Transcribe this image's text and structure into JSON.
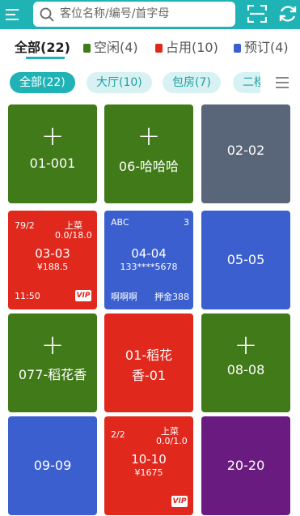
{
  "search": {
    "placeholder": "客位名称/编号/首字母"
  },
  "status_tabs": {
    "all": "全部(22)",
    "idle": "空闲(4)",
    "occupied": "占用(10)",
    "reserved": "预订(4)"
  },
  "colors": {
    "accent": "#1fb3b5",
    "idle": "#417a19",
    "occupied": "#e0281c",
    "reserved": "#3b5fcf",
    "gray": "#596579",
    "purple": "#6a1b7f"
  },
  "area_tabs": [
    "全部(22)",
    "大厅(10)",
    "包房(7)",
    "二楼"
  ],
  "tables": {
    "t1": {
      "name": "01-001"
    },
    "t2": {
      "name": "06-哈哈哈"
    },
    "t3": {
      "name": "02-02"
    },
    "t4": {
      "guests": "79/2",
      "status": "上菜",
      "progress": "0.0/18.0",
      "name": "03-03",
      "amount": "¥188.5",
      "time": "11:50",
      "vip": "VIP"
    },
    "t5": {
      "label": "ABC",
      "count": "3",
      "name": "04-04",
      "phone": "133****5678",
      "note": "啊啊啊",
      "deposit": "押金388"
    },
    "t6": {
      "name": "05-05"
    },
    "t7": {
      "name": "077-稻花香"
    },
    "t8": {
      "name_line1": "01-稻花",
      "name_line2": "香-01"
    },
    "t9": {
      "name": "08-08"
    },
    "t10": {
      "name": "09-09"
    },
    "t11": {
      "guests": "2/2",
      "status": "上菜",
      "progress": "0.0/1.0",
      "name": "10-10",
      "amount": "¥1675",
      "vip": "VIP"
    },
    "t12": {
      "name": "20-20"
    }
  }
}
